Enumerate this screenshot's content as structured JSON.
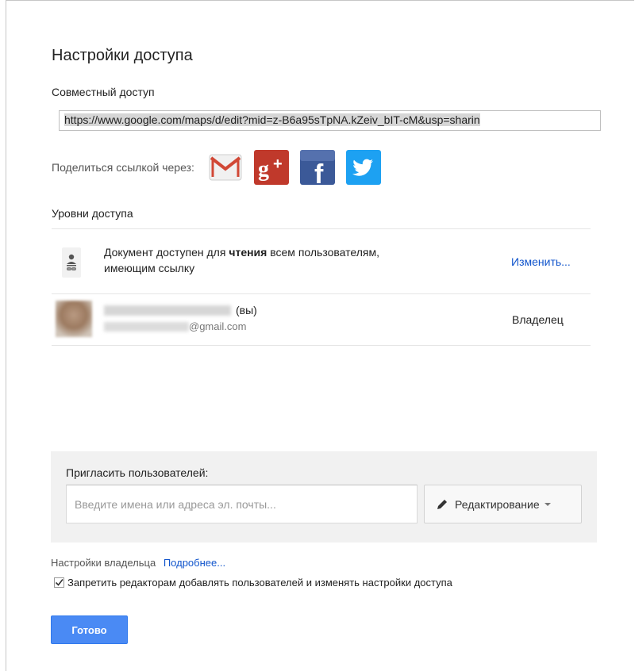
{
  "dialog": {
    "title": "Настройки доступа",
    "shared_access_label": "Совместный доступ",
    "share_link": "https://www.google.com/maps/d/edit?mid=z-B6a95sTpNA.kZeiv_bIT-cM&usp=sharin",
    "share_via_label": "Поделиться ссылкой через:",
    "share_services": [
      {
        "name": "gmail-icon"
      },
      {
        "name": "google-plus-icon"
      },
      {
        "name": "facebook-icon"
      },
      {
        "name": "twitter-icon"
      }
    ],
    "access_levels_label": "Уровни доступа"
  },
  "permissions": {
    "link_text_before": "Документ доступен для ",
    "link_text_bold": "чтения",
    "link_text_after": " всем пользователям, имеющим ссылку",
    "change_label": "Изменить...",
    "owner": {
      "name_suffix": "(вы)",
      "email_suffix": "@gmail.com",
      "role": "Владелец"
    }
  },
  "invite": {
    "label": "Пригласить пользователей:",
    "placeholder": "Введите имена или адреса эл. почты...",
    "permission_value": "Редактирование"
  },
  "owner_settings": {
    "label": "Настройки владельца",
    "more_label": "Подробнее...",
    "restrict_label": "Запретить редакторам добавлять пользователей и изменять настройки доступа",
    "restrict_checked": true
  },
  "actions": {
    "done_label": "Готово"
  },
  "colors": {
    "accent": "#4a8af4",
    "link": "#1155cc",
    "gmail_red": "#d14836",
    "gplus_red": "#c0392b",
    "facebook_blue": "#3b5998",
    "twitter_blue": "#1da1f2"
  }
}
